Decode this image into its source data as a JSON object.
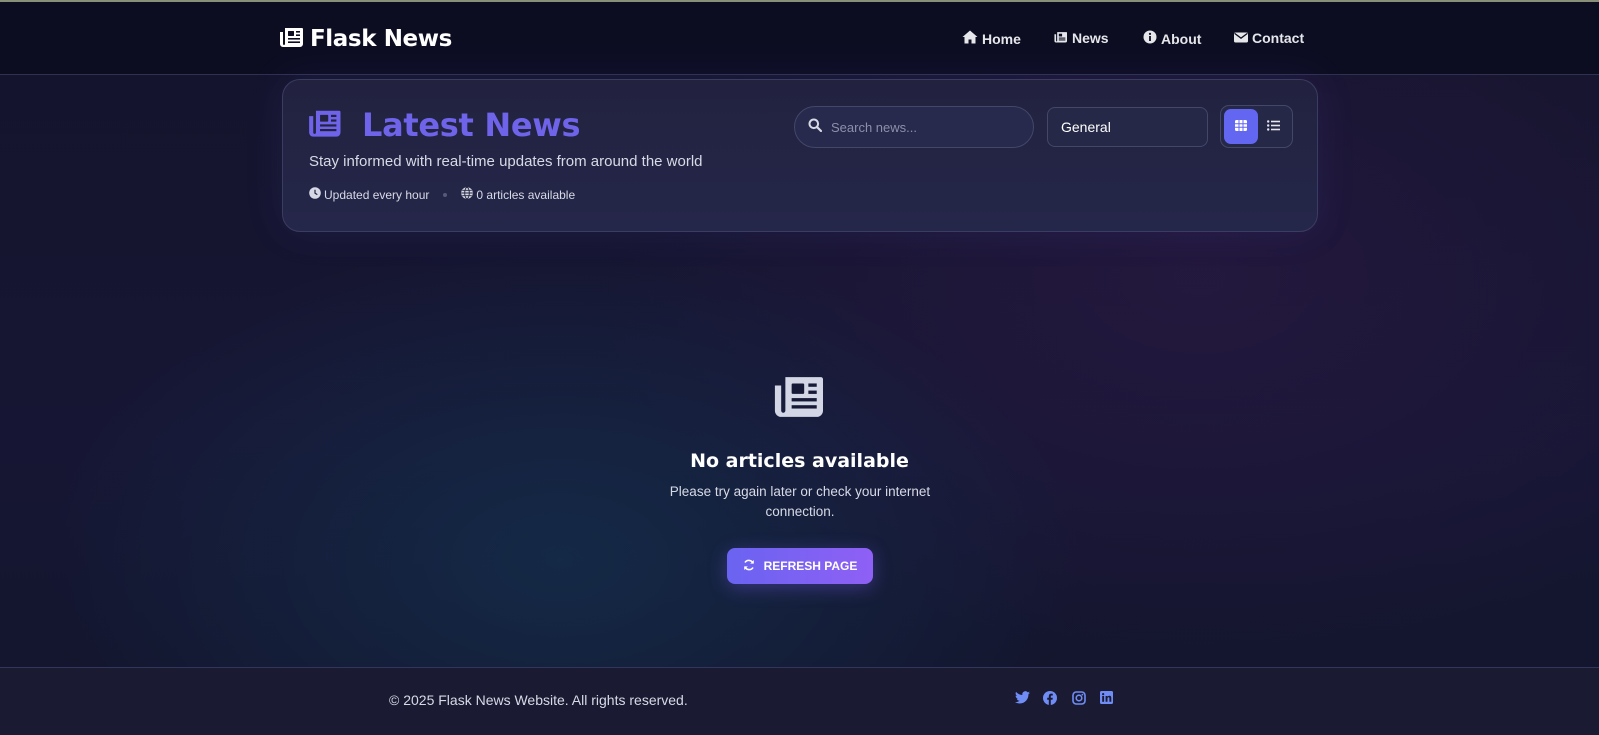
{
  "brand": {
    "name": "Flask News",
    "icon": "newspaper-icon"
  },
  "nav": [
    {
      "label": "Home",
      "icon": "home-icon"
    },
    {
      "label": "News",
      "icon": "newspaper-icon"
    },
    {
      "label": "About",
      "icon": "info-icon"
    },
    {
      "label": "Contact",
      "icon": "envelope-icon"
    }
  ],
  "header": {
    "title": "Latest News",
    "subtitle": "Stay informed with real-time updates from around the world",
    "meta": [
      {
        "text": "Updated every hour",
        "icon": "clock-icon"
      },
      {
        "text": "0 articles available",
        "icon": "globe-icon"
      }
    ],
    "search_placeholder": "Search news...",
    "search_value": "",
    "category": "General",
    "view_mode": "grid"
  },
  "empty_state": {
    "icon": "newspaper-icon",
    "title": "No articles available",
    "message": "Please try again later or check your internet connection.",
    "button_label": "REFRESH PAGE",
    "button_icon": "refresh-icon"
  },
  "footer": {
    "copyright": "© 2025 Flask News Website. All rights reserved.",
    "social": [
      "twitter-icon",
      "facebook-icon",
      "instagram-icon",
      "linkedin-icon"
    ]
  },
  "colors": {
    "accent": "#6366f1",
    "title": "#6f63ea",
    "social": "#6f8df5",
    "navbar_bg": "#0d0d22"
  }
}
